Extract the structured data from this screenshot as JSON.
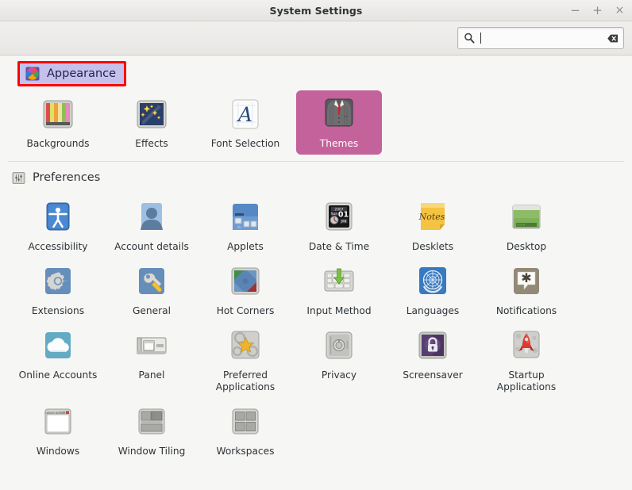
{
  "window": {
    "title": "System Settings",
    "controls": [
      {
        "name": "minimize",
        "glyph": "−"
      },
      {
        "name": "maximize",
        "glyph": "+"
      },
      {
        "name": "close",
        "glyph": "×"
      }
    ]
  },
  "search": {
    "value": "",
    "placeholder": "",
    "icon": "search-icon",
    "clear_icon": "clear-icon"
  },
  "sections": [
    {
      "id": "appearance",
      "label": "Appearance",
      "icon": "appearance-pinwheel-icon",
      "highlighted": true,
      "items": [
        {
          "label": "Backgrounds",
          "icon": "backgrounds-icon",
          "selected": false
        },
        {
          "label": "Effects",
          "icon": "effects-icon",
          "selected": false
        },
        {
          "label": "Font Selection",
          "icon": "font-selection-icon",
          "selected": false
        },
        {
          "label": "Themes",
          "icon": "themes-icon",
          "selected": true
        }
      ]
    },
    {
      "id": "preferences",
      "label": "Preferences",
      "icon": "preferences-sliders-icon",
      "highlighted": false,
      "items": [
        {
          "label": "Accessibility",
          "icon": "accessibility-icon",
          "selected": false
        },
        {
          "label": "Account details",
          "icon": "account-details-icon",
          "selected": false
        },
        {
          "label": "Applets",
          "icon": "applets-icon",
          "selected": false
        },
        {
          "label": "Date & Time",
          "icon": "date-time-icon",
          "selected": false
        },
        {
          "label": "Desklets",
          "icon": "desklets-icon",
          "selected": false
        },
        {
          "label": "Desktop",
          "icon": "desktop-icon",
          "selected": false
        },
        {
          "label": "Extensions",
          "icon": "extensions-icon",
          "selected": false
        },
        {
          "label": "General",
          "icon": "general-icon",
          "selected": false
        },
        {
          "label": "Hot Corners",
          "icon": "hot-corners-icon",
          "selected": false
        },
        {
          "label": "Input Method",
          "icon": "input-method-icon",
          "selected": false
        },
        {
          "label": "Languages",
          "icon": "languages-icon",
          "selected": false
        },
        {
          "label": "Notifications",
          "icon": "notifications-icon",
          "selected": false
        },
        {
          "label": "Online Accounts",
          "icon": "online-accounts-icon",
          "selected": false
        },
        {
          "label": "Panel",
          "icon": "panel-icon",
          "selected": false
        },
        {
          "label": "Preferred Applications",
          "icon": "preferred-applications-icon",
          "selected": false
        },
        {
          "label": "Privacy",
          "icon": "privacy-icon",
          "selected": false
        },
        {
          "label": "Screensaver",
          "icon": "screensaver-icon",
          "selected": false
        },
        {
          "label": "Startup Applications",
          "icon": "startup-applications-icon",
          "selected": false
        },
        {
          "label": "Windows",
          "icon": "windows-icon",
          "selected": false
        },
        {
          "label": "Window Tiling",
          "icon": "window-tiling-icon",
          "selected": false
        },
        {
          "label": "Workspaces",
          "icon": "workspaces-icon",
          "selected": false
        }
      ]
    }
  ],
  "date_time_icon_text": {
    "year": "2007",
    "day": "Sun",
    "date": "01",
    "month": "JAN"
  },
  "desklets_icon_text": "Notes",
  "colors": {
    "selection": "#c4629c",
    "highlight_border": "#fe0000",
    "highlight_fill": "#c5c0ec",
    "window_bg": "#f6f6f5",
    "text": "#2e3436"
  }
}
